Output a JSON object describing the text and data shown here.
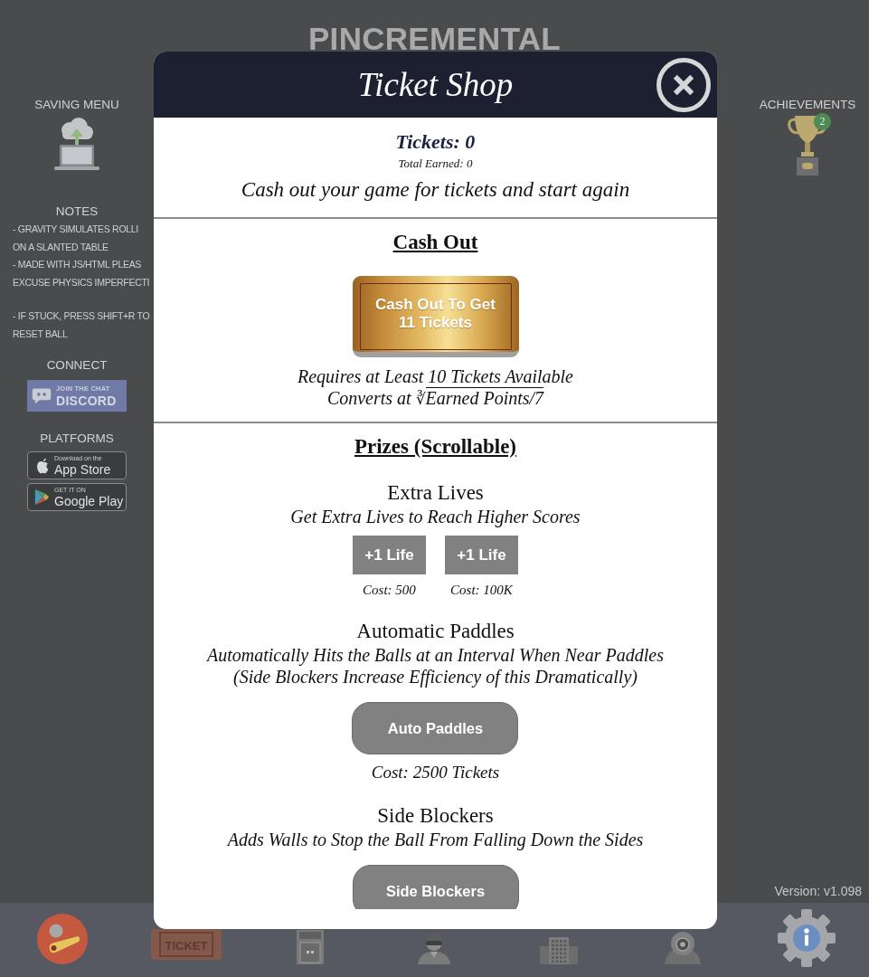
{
  "header": {
    "title": "PINCREMENTAL"
  },
  "left_sidebar": {
    "saving_menu": {
      "label": "SAVING MENU"
    },
    "notes": {
      "heading": "NOTES",
      "paragraphs": [
        [
          "- GRAVITY SIMULATES ROLLI",
          "ON A SLANTED TABLE",
          "- MADE WITH JS/HTML PLEAS",
          "EXCUSE PHYSICS IMPERFECTI"
        ],
        [
          "- IF STUCK, PRESS SHIFT+R TO",
          "RESET BALL"
        ]
      ]
    },
    "connect": {
      "heading": "CONNECT",
      "discord": {
        "caption": "JOIN THE CHAT",
        "name": "DISCORD"
      }
    },
    "platforms": {
      "heading": "PLATFORMS",
      "badges": [
        {
          "kind": "apple",
          "caption": "Download on the",
          "name": "App Store"
        },
        {
          "kind": "google",
          "caption": "GET IT ON",
          "name": "Google Play"
        }
      ]
    }
  },
  "right_sidebar": {
    "achievements": {
      "label": "ACHIEVEMENTS",
      "count": "2"
    },
    "version": "Version: v1.098"
  },
  "modal": {
    "title": "Ticket Shop",
    "tickets": "Tickets: 0",
    "total_earned": "Total Earned: 0",
    "intro": "Cash out your game for tickets and start again",
    "cash_out": {
      "heading": "Cash Out",
      "button": "Cash Out To Get 11 Tickets",
      "requirement": "Requires at Least 10 Tickets Available",
      "formula": {
        "prefix": "Converts at",
        "radical": "∛",
        "radicand": "Earned Points/7"
      }
    },
    "prizes": {
      "heading": "Prizes (Scrollable)",
      "items": [
        {
          "kind": "options",
          "title": "Extra Lives",
          "description": [
            "Get Extra Lives to Reach Higher Scores"
          ],
          "options": [
            {
              "label": "+1 Life",
              "cost": "Cost: 500"
            },
            {
              "label": "+1 Life",
              "cost": "Cost: 100K"
            }
          ]
        },
        {
          "kind": "single",
          "title": "Automatic Paddles",
          "description": [
            "Automatically Hits the Balls at an Interval When Near Paddles",
            "(Side Blockers Increase Efficiency of this Dramatically)"
          ],
          "button": "Auto Paddles",
          "cost": "Cost: 2500 Tickets"
        },
        {
          "kind": "single",
          "title": "Side Blockers",
          "description": [
            "Adds Walls to Stop the Ball From Falling Down the Sides"
          ],
          "button": "Side Blockers"
        }
      ]
    }
  },
  "bottom_nav": {
    "items": [
      {
        "kind": "pinball"
      },
      {
        "kind": "ticket",
        "label": "TICKET"
      },
      {
        "kind": "cabinet"
      },
      {
        "kind": "agent"
      },
      {
        "kind": "building"
      },
      {
        "kind": "helmet"
      },
      {
        "kind": "settings"
      }
    ]
  }
}
